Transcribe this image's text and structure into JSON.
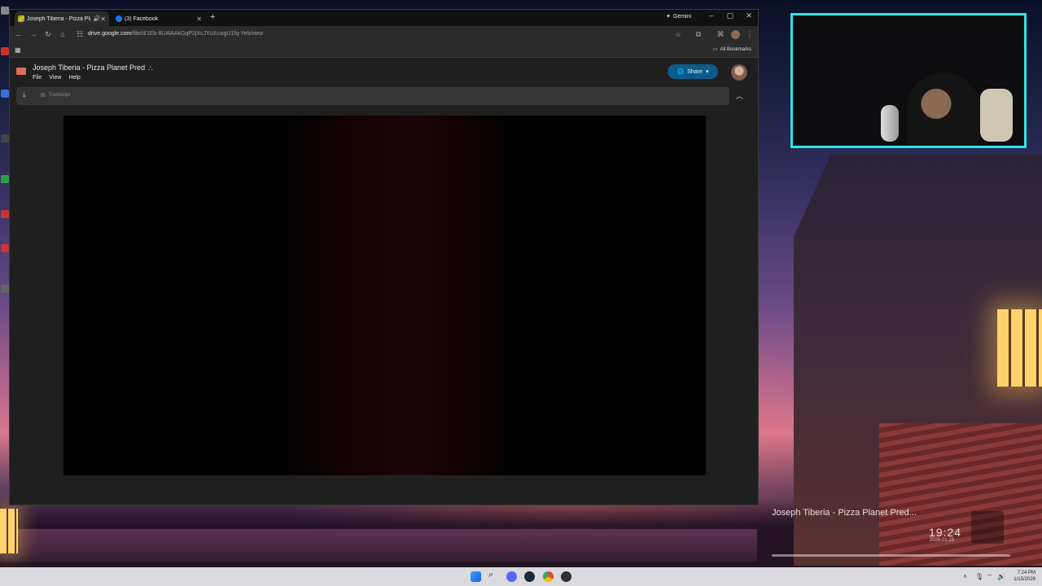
{
  "browser": {
    "tabs": [
      {
        "label": "Joseph Tiberia - Pizza Plane",
        "active": true,
        "favicon": "google-drive-icon",
        "audio": true
      },
      {
        "label": "(3) Facebook",
        "active": false,
        "favicon": "facebook-icon"
      }
    ],
    "gemini_label": "Gemini",
    "url_host": "drive.google.com",
    "url_path": "/file/d/1Eb-8U4lAAkGqP2jXcJYuXcwgU1fq-Yeb/view",
    "bookmarks_label": "All Bookmarks"
  },
  "drive": {
    "title": "Joseph Tiberia - Pizza Planet Pred",
    "menu": [
      "File",
      "View",
      "Help"
    ],
    "share_label": "Share",
    "transcript_label": "Transcript"
  },
  "now_playing": {
    "title": "Joseph Tiberia - Pizza Planet Pred...",
    "time": "19:24",
    "date": "2026.01.15"
  },
  "taskbar": {
    "clock_time": "7:24 PM",
    "clock_date": "1/15/2026",
    "apps": [
      "windows-start-icon",
      "search-icon",
      "discord-icon",
      "steam-icon",
      "chrome-icon",
      "obs-icon"
    ]
  },
  "colors": {
    "webcam_border": "#2fe3e8",
    "share_button": "#0b5c8a"
  }
}
